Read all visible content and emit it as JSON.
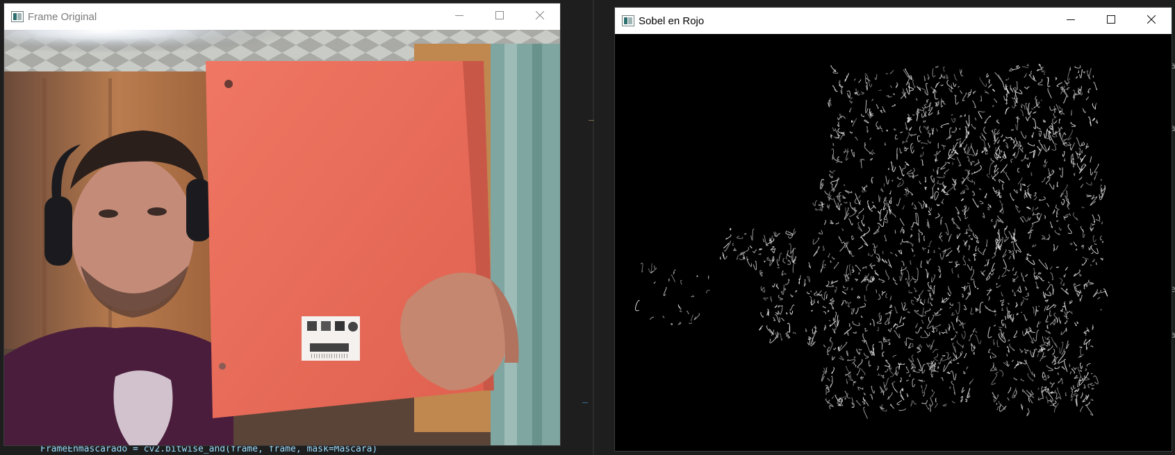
{
  "windows": {
    "original": {
      "title": "Frame Original",
      "label_barcode_text": "|||||||||||||||"
    },
    "sobel": {
      "title": "Sobel en Rojo"
    }
  },
  "editor": {
    "code_line": "FrameEnmascarado = cv2.bitwise_and(frame, frame, mask=Mascara)",
    "right_edge_chars": [
      "a",
      "a",
      "e",
      "a"
    ]
  },
  "icons": {
    "app": "opencv-window-icon",
    "minimize": "minimize-icon",
    "maximize": "maximize-icon",
    "close": "close-icon"
  },
  "colors": {
    "notebook": "#ea6b58",
    "shirt": "#4a1d3c",
    "wall": "#c48a5a",
    "edges": "#e6e6e6",
    "editor_bg": "#1e1e1e"
  }
}
